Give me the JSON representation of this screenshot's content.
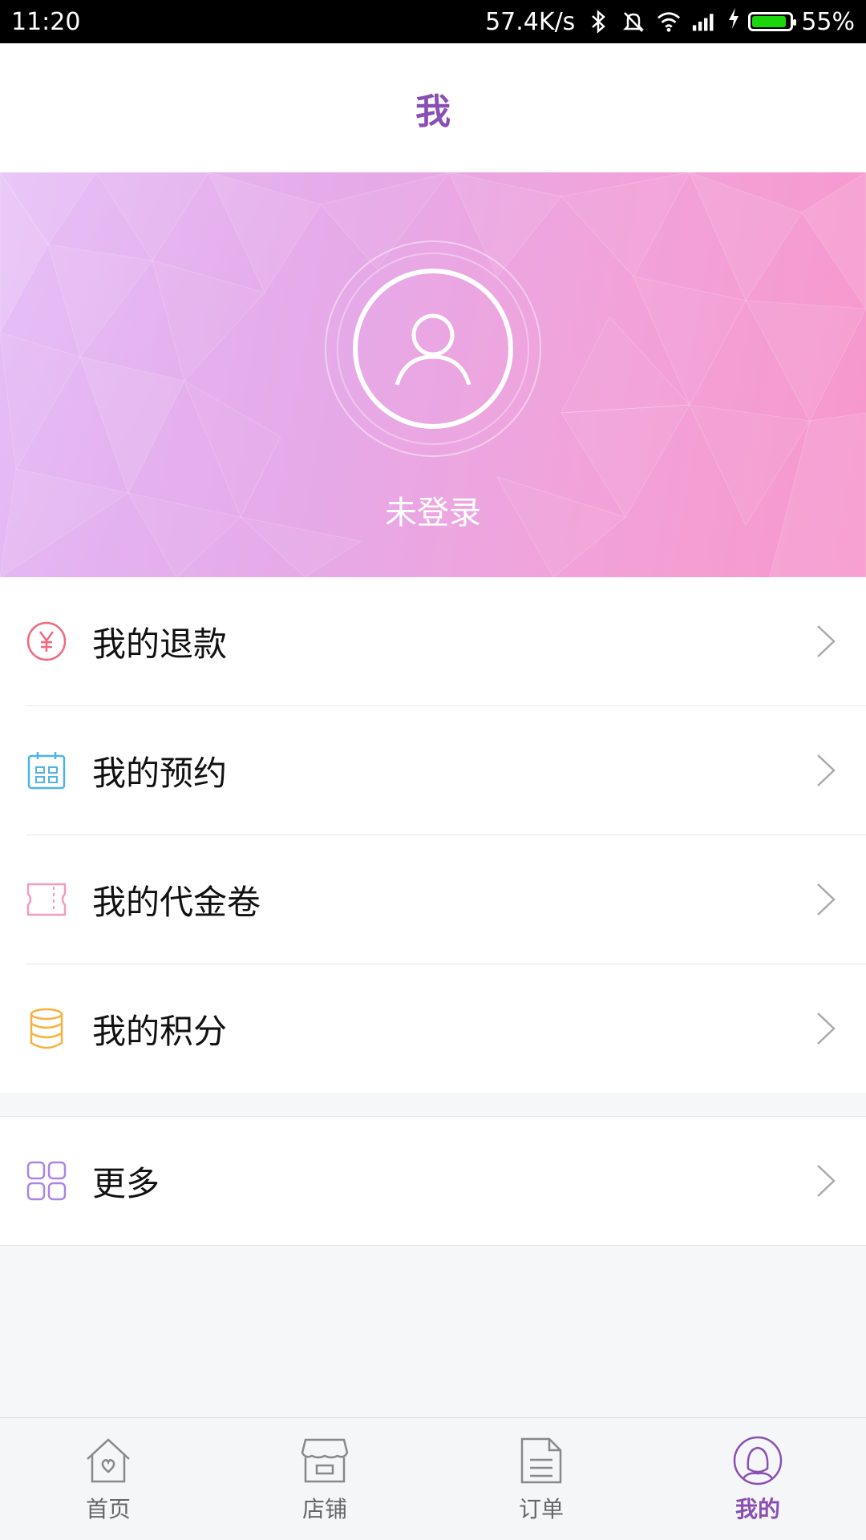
{
  "status_bar": {
    "time": "11:20",
    "net_speed": "57.4K/s",
    "battery_percent": "55%",
    "battery_level": 0.9,
    "icons": [
      "bluetooth-icon",
      "mute-icon",
      "wifi-icon",
      "signal-icon",
      "charging-icon",
      "battery-icon"
    ]
  },
  "header": {
    "title": "我"
  },
  "profile": {
    "login_status": "未登录",
    "avatar_icon": "user-icon"
  },
  "menu": {
    "items": [
      {
        "label": "我的退款",
        "icon": "yen-icon",
        "color": "#f06a7c"
      },
      {
        "label": "我的预约",
        "icon": "calendar-icon",
        "color": "#4fb3e8"
      },
      {
        "label": "我的代金卷",
        "icon": "ticket-icon",
        "color": "#f39bc0"
      },
      {
        "label": "我的积分",
        "icon": "coins-icon",
        "color": "#f5b23a"
      }
    ],
    "more": {
      "label": "更多",
      "icon": "grid-icon",
      "color": "#a986e3"
    }
  },
  "tabbar": {
    "tabs": [
      {
        "label": "首页",
        "icon": "home-icon"
      },
      {
        "label": "店铺",
        "icon": "store-icon"
      },
      {
        "label": "订单",
        "icon": "order-icon"
      },
      {
        "label": "我的",
        "icon": "profile-icon",
        "active": true
      }
    ],
    "active_color": "#8a4fb4"
  }
}
